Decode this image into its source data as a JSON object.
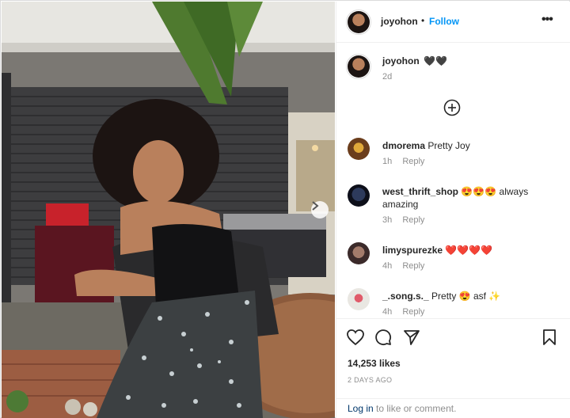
{
  "header": {
    "username": "joyohon",
    "separator": "•",
    "follow_label": "Follow",
    "more_label": "•••"
  },
  "caption": {
    "username": "joyohon",
    "text": "🖤🖤",
    "time": "2d"
  },
  "comments": [
    {
      "username": "dmorema",
      "text": "Pretty Joy",
      "time": "1h",
      "reply_label": "Reply"
    },
    {
      "username": "west_thrift_shop",
      "text": "😍😍😍 always amazing",
      "time": "3h",
      "reply_label": "Reply"
    },
    {
      "username": "limyspurezke",
      "text": "❤️❤️❤️❤️",
      "time": "4h",
      "reply_label": "Reply"
    },
    {
      "username": "_.song.s._",
      "text": "Pretty 😍 asf ✨",
      "time": "4h",
      "reply_label": "Reply"
    }
  ],
  "stats": {
    "likes": "14,253 likes",
    "post_age": "2 DAYS AGO"
  },
  "login": {
    "link_label": "Log in",
    "suffix": "to like or comment."
  },
  "colors": {
    "accent": "#0095f6",
    "link_dark": "#00376b",
    "muted": "#8e8e8e",
    "heart_red": "#ed4956"
  },
  "icons": [
    "more-icon",
    "load-more-comments-icon",
    "like-icon",
    "comment-icon",
    "share-icon",
    "save-icon",
    "next-photo-icon"
  ]
}
